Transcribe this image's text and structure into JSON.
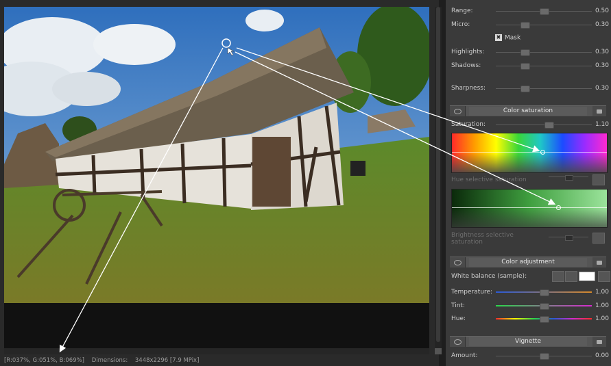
{
  "status": {
    "rgb": "[R:037%, G:051%, B:069%]",
    "dimensions_label": "Dimensions:",
    "dimensions_value": "3448x2296 [7.9 MPix]"
  },
  "panel": {
    "range": {
      "label": "Range:",
      "value": "0.50",
      "level": 0.5
    },
    "micro": {
      "label": "Micro:",
      "value": "0.30",
      "level": 0.3
    },
    "mask_label": "Mask",
    "highlights": {
      "label": "Highlights:",
      "value": "0.30",
      "level": 0.3
    },
    "shadows": {
      "label": "Shadows:",
      "value": "0.30",
      "level": 0.3
    },
    "sharpness": {
      "label": "Sharpness:",
      "value": "0.30",
      "level": 0.3
    },
    "color_saturation": {
      "title": "Color saturation",
      "saturation": {
        "label": "Saturation:",
        "value": "1.10",
        "level": 0.55
      },
      "hue_selective_label": "Hue selective saturation",
      "brightness_selective_label": "Brightness selective saturation"
    },
    "color_adjustment": {
      "title": "Color adjustment",
      "white_balance_label": "White balance (sample):",
      "temperature": {
        "label": "Temperature:",
        "value": "1.00",
        "level": 0.5
      },
      "tint": {
        "label": "Tint:",
        "value": "1.00",
        "level": 0.5
      },
      "hue": {
        "label": "Hue:",
        "value": "1.00",
        "level": 0.5
      }
    },
    "vignette": {
      "title": "Vignette",
      "amount": {
        "label": "Amount:",
        "value": "0.00",
        "level": 0.5
      }
    }
  },
  "colors": {
    "panel_bg": "#3a3a3a",
    "section_bg": "#5b5b5b",
    "sky": "#3f7fc8",
    "grass": "#4f7d23"
  }
}
